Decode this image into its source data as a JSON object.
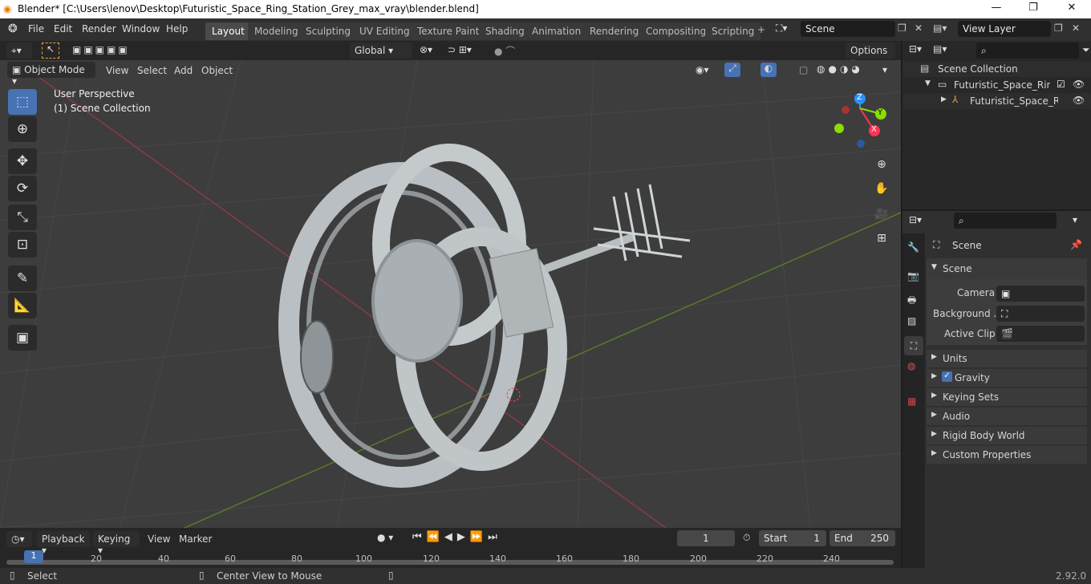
{
  "window": {
    "title": "Blender* [C:\\Users\\lenov\\Desktop\\Futuristic_Space_Ring_Station_Grey_max_vray\\blender.blend]"
  },
  "menu": [
    "File",
    "Edit",
    "Render",
    "Window",
    "Help"
  ],
  "workspaces": [
    "Layout",
    "Modeling",
    "Sculpting",
    "UV Editing",
    "Texture Paint",
    "Shading",
    "Animation",
    "Rendering",
    "Compositing",
    "Scripting"
  ],
  "scene_field": "Scene",
  "view_layer_field": "View Layer",
  "viewport": {
    "mode": "Object Mode",
    "menus": [
      "View",
      "Select",
      "Add",
      "Object"
    ],
    "transform": "Global",
    "options": "Options",
    "overlay_title": "User Perspective",
    "overlay_sub": "(1) Scene Collection",
    "gizmo": {
      "z": "Z",
      "y": "Y",
      "x": "X"
    }
  },
  "outliner": {
    "root": "Scene Collection",
    "collection": "Futuristic_Space_Ring_St",
    "object": "Futuristic_Space_Rir"
  },
  "properties": {
    "context": "Scene",
    "panel": "Scene",
    "camera_label": "Camera",
    "background_label": "Background ...",
    "active_clip_label": "Active Clip",
    "sections": [
      "Units",
      "Gravity",
      "Keying Sets",
      "Audio",
      "Rigid Body World",
      "Custom Properties"
    ]
  },
  "timeline": {
    "menus": [
      "Playback",
      "Keying",
      "View",
      "Marker"
    ],
    "current_frame": "1",
    "start_label": "Start",
    "start": "1",
    "end_label": "End",
    "end": "250",
    "ticks": [
      "1",
      "20",
      "40",
      "60",
      "80",
      "100",
      "120",
      "140",
      "160",
      "180",
      "200",
      "220",
      "240"
    ]
  },
  "status": {
    "left": "Select",
    "middle": "Center View to Mouse",
    "version": "2.92.0"
  },
  "colors": {
    "accent": "#4772b3",
    "axis_x": "#ff3352",
    "axis_y": "#8bdc00",
    "axis_z": "#2890ff"
  }
}
